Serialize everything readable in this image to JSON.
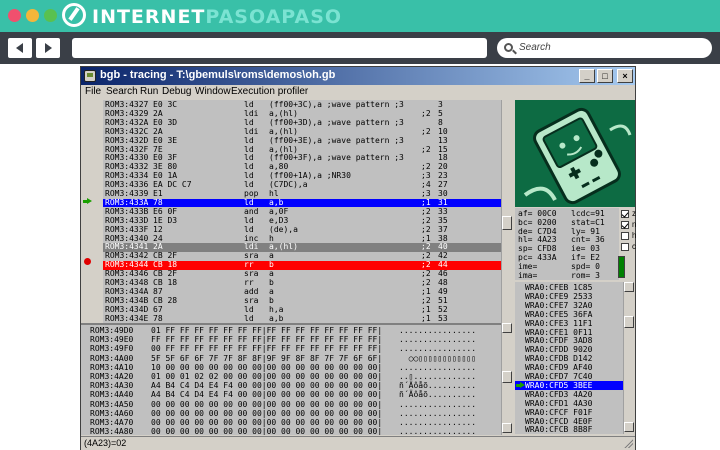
{
  "brand": {
    "logo_prefix": "INTERNET",
    "logo_accent": "PASOAPASO",
    "accent_color": "#39c0a8"
  },
  "browser": {
    "search_placeholder": "Search"
  },
  "window": {
    "title": "bgb - tracing - T:\\gbemuls\\roms\\demos\\oh.gb",
    "menu": [
      "File",
      "Search",
      "Run",
      "Debug",
      "Window",
      "Execution profiler"
    ]
  },
  "disasm": [
    {
      "addr": "ROM3:4327",
      "bytes": "E0 3C",
      "op": "ld",
      "arg": "(ff00+3C),a ;wave pattern ;3",
      "n": "3",
      "hl": ""
    },
    {
      "addr": "ROM3:4329",
      "bytes": "2A",
      "op": "ldi",
      "arg": "a,(hl)",
      "cyc": ";2",
      "n": "5",
      "hl": ""
    },
    {
      "addr": "ROM3:432A",
      "bytes": "E0 3D",
      "op": "ld",
      "arg": "(ff00+3D),a ;wave pattern ;3",
      "n": "8",
      "hl": ""
    },
    {
      "addr": "ROM3:432C",
      "bytes": "2A",
      "op": "ldi",
      "arg": "a,(hl)",
      "cyc": ";2",
      "n": "10",
      "hl": ""
    },
    {
      "addr": "ROM3:432D",
      "bytes": "E0 3E",
      "op": "ld",
      "arg": "(ff00+3E),a ;wave pattern ;3",
      "n": "13",
      "hl": ""
    },
    {
      "addr": "ROM3:432F",
      "bytes": "7E",
      "op": "ld",
      "arg": "a,(hl)",
      "cyc": ";2",
      "n": "15",
      "hl": ""
    },
    {
      "addr": "ROM3:4330",
      "bytes": "E0 3F",
      "op": "ld",
      "arg": "(ff00+3F),a ;wave pattern ;3",
      "n": "18",
      "hl": ""
    },
    {
      "addr": "ROM3:4332",
      "bytes": "3E 80",
      "op": "ld",
      "arg": "a,80",
      "cyc": ";2",
      "n": "20",
      "hl": ""
    },
    {
      "addr": "ROM3:4334",
      "bytes": "E0 1A",
      "op": "ld",
      "arg": "(ff00+1A),a ;NR30",
      "cyc": ";3",
      "n": "23",
      "hl": ""
    },
    {
      "addr": "ROM3:4336",
      "bytes": "EA DC C7",
      "op": "ld",
      "arg": "(C7DC),a",
      "cyc": ";4",
      "n": "27",
      "hl": ""
    },
    {
      "addr": "ROM3:4339",
      "bytes": "E1",
      "op": "pop",
      "arg": "hl",
      "cyc": ";3",
      "n": "30",
      "hl": ""
    },
    {
      "addr": "ROM3:433A",
      "bytes": "78",
      "op": "ld",
      "arg": "a,b",
      "cyc": ";1",
      "n": "31",
      "hl": "blue"
    },
    {
      "addr": "ROM3:433B",
      "bytes": "E6 0F",
      "op": "and",
      "arg": "a,0F",
      "cyc": ";2",
      "n": "33",
      "hl": ""
    },
    {
      "addr": "ROM3:433D",
      "bytes": "1E D3",
      "op": "ld",
      "arg": "e,D3",
      "cyc": ";2",
      "n": "35",
      "hl": ""
    },
    {
      "addr": "ROM3:433F",
      "bytes": "12",
      "op": "ld",
      "arg": "(de),a",
      "cyc": ";2",
      "n": "37",
      "hl": ""
    },
    {
      "addr": "ROM3:4340",
      "bytes": "24",
      "op": "inc",
      "arg": "h",
      "cyc": ";1",
      "n": "38",
      "hl": ""
    },
    {
      "addr": "ROM3:4341",
      "bytes": "2A",
      "op": "ldi",
      "arg": "a,(hl)",
      "cyc": ";2",
      "n": "40",
      "hl": "gray"
    },
    {
      "addr": "ROM3:4342",
      "bytes": "CB 2F",
      "op": "sra",
      "arg": "a",
      "cyc": ";2",
      "n": "42",
      "hl": ""
    },
    {
      "addr": "ROM3:4344",
      "bytes": "CB 18",
      "op": "rr",
      "arg": "b",
      "cyc": ";2",
      "n": "44",
      "hl": "red"
    },
    {
      "addr": "ROM3:4346",
      "bytes": "CB 2F",
      "op": "sra",
      "arg": "a",
      "cyc": ";2",
      "n": "46",
      "hl": ""
    },
    {
      "addr": "ROM3:4348",
      "bytes": "CB 18",
      "op": "rr",
      "arg": "b",
      "cyc": ";2",
      "n": "48",
      "hl": ""
    },
    {
      "addr": "ROM3:434A",
      "bytes": "87",
      "op": "add",
      "arg": "a",
      "cyc": ";1",
      "n": "49",
      "hl": ""
    },
    {
      "addr": "ROM3:434B",
      "bytes": "CB 28",
      "op": "sra",
      "arg": "b",
      "cyc": ";2",
      "n": "51",
      "hl": ""
    },
    {
      "addr": "ROM3:434D",
      "bytes": "67",
      "op": "ld",
      "arg": "h,a",
      "cyc": ";1",
      "n": "52",
      "hl": ""
    },
    {
      "addr": "ROM3:434E",
      "bytes": "78",
      "op": "ld",
      "arg": "a,b",
      "cyc": ";1",
      "n": "53",
      "hl": ""
    }
  ],
  "registers": [
    [
      "af= 00C0",
      "lcdc=91"
    ],
    [
      "bc= 0200",
      "stat=C1"
    ],
    [
      "de= C7D4",
      "ly= 91"
    ],
    [
      "hl= 4A23",
      "cnt= 36"
    ],
    [
      "sp= CFD8",
      "ie= 03"
    ],
    [
      "pc= 433A",
      "if= E2"
    ],
    [
      "ime=",
      "spd= 0"
    ],
    [
      "ima=",
      "rom= 3"
    ]
  ],
  "flags": [
    {
      "label": "z",
      "checked": true
    },
    {
      "label": "n",
      "checked": true
    },
    {
      "label": "h",
      "checked": false
    },
    {
      "label": "c",
      "checked": false
    }
  ],
  "memory": [
    {
      "addr": "ROM3:49D0",
      "hex": "01 FF FF FF FF FF FF FF|FF FF FF FF FF FF FF FF|",
      "ascii": "................"
    },
    {
      "addr": "ROM3:49E0",
      "hex": "FF FF FF FF FF FF FF FF|FF FF FF FF FF FF FF FF|",
      "ascii": "................"
    },
    {
      "addr": "ROM3:49F0",
      "hex": "00 FF FF FF FF FF FF FF|FF FF FF FF FF FF FF FF|",
      "ascii": "................"
    },
    {
      "addr": "ROM3:4A00",
      "hex": "5F 5F 6F 6F 7F 7F 8F 8F|9F 9F 8F 8F 7F 7F 6F 6F|",
      "ascii": "  ○○▯▯▯▯▯▯▯▯▯▯▯▯"
    },
    {
      "addr": "ROM3:4A10",
      "hex": "10 00 00 00 00 00 00 00|00 00 00 00 00 00 00 00|",
      "ascii": "................"
    },
    {
      "addr": "ROM3:4A20",
      "hex": "01 00 01 02 02 00 00 00|00 00 00 00 00 00 00 00|",
      "ascii": "..▯............."
    },
    {
      "addr": "ROM3:4A30",
      "hex": "A4 B4 C4 D4 E4 F4 00 00|00 00 00 00 00 00 00 00|",
      "ascii": "ñ´Äôåõ.........."
    },
    {
      "addr": "ROM3:4A40",
      "hex": "A4 B4 C4 D4 E4 F4 00 00|00 00 00 00 00 00 00 00|",
      "ascii": "ñ´Äôåõ.........."
    },
    {
      "addr": "ROM3:4A50",
      "hex": "00 00 00 00 00 00 00 00|00 00 00 00 00 00 00 00|",
      "ascii": "................"
    },
    {
      "addr": "ROM3:4A60",
      "hex": "00 00 00 00 00 00 00 00|00 00 00 00 00 00 00 00|",
      "ascii": "................"
    },
    {
      "addr": "ROM3:4A70",
      "hex": "00 00 00 00 00 00 00 00|00 00 00 00 00 00 00 00|",
      "ascii": "................"
    },
    {
      "addr": "ROM3:4A80",
      "hex": "00 00 00 00 00 00 00 00|00 00 00 00 00 00 00 00|",
      "ascii": "................"
    }
  ],
  "stack": [
    {
      "text": "WRA0:CFEB 1C85",
      "sel": false
    },
    {
      "text": "WRA0:CFE9 2533",
      "sel": false
    },
    {
      "text": "WRA0:CFE7 32A0",
      "sel": false
    },
    {
      "text": "WRA0:CFE5 36FA",
      "sel": false
    },
    {
      "text": "WRA0:CFE3 11F1",
      "sel": false
    },
    {
      "text": "WRA0:CFE1 0F11",
      "sel": false
    },
    {
      "text": "WRA0:CFDF 3AD8",
      "sel": false
    },
    {
      "text": "WRA0:CFDD 9020",
      "sel": false
    },
    {
      "text": "WRA0:CFDB D142",
      "sel": false
    },
    {
      "text": "WRA0:CFD9 AF40",
      "sel": false
    },
    {
      "text": "WRA0:CFD7 7C40",
      "sel": false
    },
    {
      "text": "WRA0:CFD5 3BEE",
      "sel": true
    },
    {
      "text": "WRA0:CFD3 4A20",
      "sel": false
    },
    {
      "text": "WRA0:CFD1 4A30",
      "sel": false
    },
    {
      "text": "WRA0:CFCF F01F",
      "sel": false
    },
    {
      "text": "WRA0:CFCD 4E0F",
      "sel": false
    },
    {
      "text": "WRA0:CFCB 8B8F",
      "sel": false
    }
  ],
  "status": "(4A23)=02"
}
